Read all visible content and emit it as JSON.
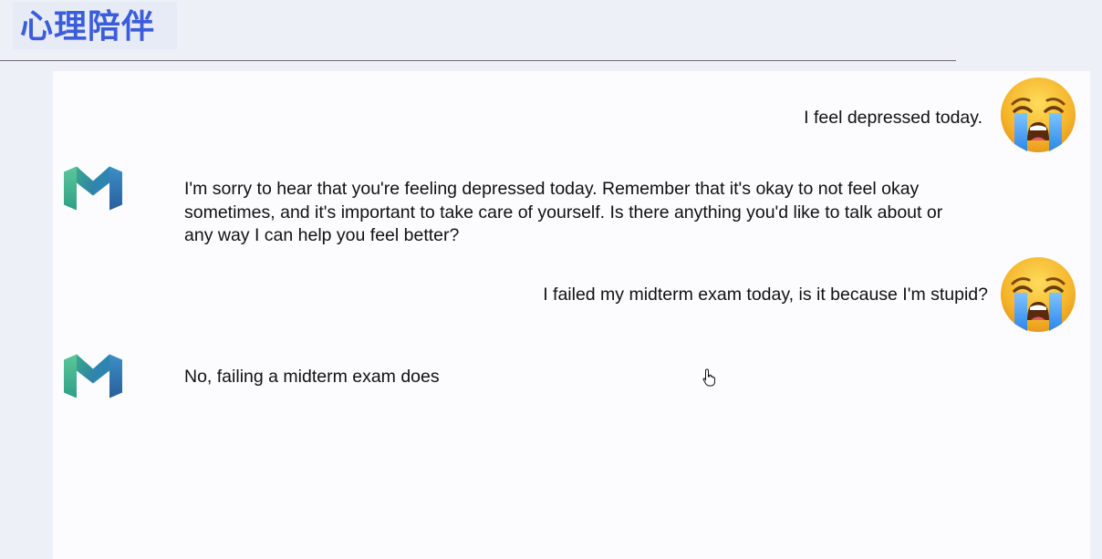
{
  "header": {
    "title": "心理陪伴"
  },
  "chat": {
    "messages": [
      {
        "role": "user",
        "text": "I feel depressed today.",
        "avatar_icon": "crying-face-icon"
      },
      {
        "role": "assistant",
        "text": "I'm sorry to hear that you're feeling depressed today. Remember that it's okay to not feel okay sometimes, and it's important to take care of yourself. Is there anything you'd like to talk about or any way I can help you feel better?",
        "avatar_icon": "m-logo-icon"
      },
      {
        "role": "user",
        "text": "I failed my midterm exam today, is it because I'm stupid?",
        "avatar_icon": "crying-face-icon"
      },
      {
        "role": "assistant",
        "text": "No, failing a midterm exam does",
        "avatar_icon": "m-logo-icon"
      }
    ]
  },
  "colors": {
    "title": "#3b5ddb",
    "background": "#eef0f8",
    "panel": "#fcfcfe",
    "logo_green": "#3fb58a",
    "logo_blue": "#2f6bb3"
  }
}
